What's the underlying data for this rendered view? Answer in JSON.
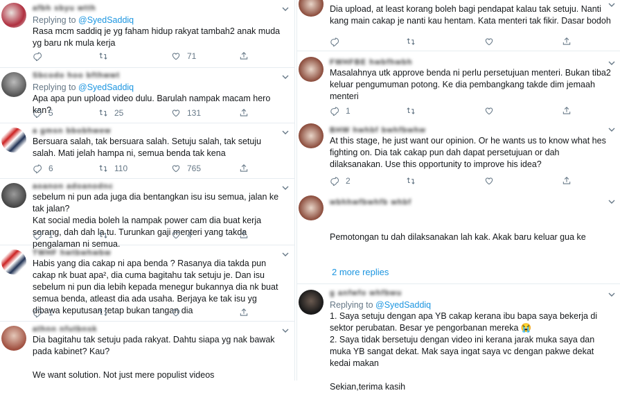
{
  "left": [
    {
      "name": "afbh sbyu wtth",
      "reply": "@SyedSaddiq",
      "text": "Rasa mcm saddiq je yg faham hidup rakyat tambah2 anak muda yg baru nk mula kerja",
      "replies": "",
      "retweets": "",
      "likes": "71"
    },
    {
      "name": "Sbcodo hoo bfthwwt",
      "reply": "@SyedSaddiq",
      "text": "Apa apa pun upload video dulu. Barulah nampak macam hero kan?",
      "replies": "5",
      "retweets": "25",
      "likes": "131"
    },
    {
      "name": "a gmsn bbobhwew",
      "reply": "",
      "text": "Bersuara salah, tak bersuara salah. Setuju salah, tak setuju salah. Mati jelah hampa ni, semua benda tak kena",
      "replies": "6",
      "retweets": "110",
      "likes": "765"
    },
    {
      "name": "aoanon adoanodnc",
      "reply": "",
      "text": "sebelum ni pun ada juga dia bentangkan isu isu semua, jalan ke tak jalan?\nKat social media boleh la nampak power cam dia buat kerja sorang, dah dah la tu. Turunkan gaji menteri yang takda pengalaman ni semua.",
      "replies": "1",
      "retweets": "",
      "likes": "4"
    },
    {
      "name": "TWHF hwtbwhwbw",
      "reply": "",
      "text": "Habis yang dia cakap ni apa benda ? Rasanya dia takda pun cakap nk buat apa², dia cuma bagitahu tak setuju je. Dan isu sebelum ni pun dia lebih kepada menegur bukannya dia nk buat semua benda, atleast dia ada usaha. Berjaya ke tak isu yg dibawa keputusan tetap bukan tangan dia",
      "replies": "1",
      "retweets": "",
      "likes": ""
    },
    {
      "name": "athnn nfutbnsk",
      "reply": "",
      "text": "Dia bagitahu tak setuju pada rakyat. Dahtu siapa yg nak bawak pada kabinet? Kau?\n\nWe want solution. Not just mere populist videos",
      "replies": "",
      "retweets": "",
      "likes": ""
    }
  ],
  "right": [
    {
      "name": "",
      "reply": "",
      "text": "Dia upload, at least korang boleh bagi pendapat kalau tak setuju. Nanti kang main cakap je nanti kau hentam. Kata menteri tak fikir. Dasar bodoh",
      "replies": "",
      "retweets": "",
      "likes": ""
    },
    {
      "name": "FWHFBE hwbfhwbh",
      "reply": "",
      "text": "Masalahnya utk approve benda ni perlu persetujuan menteri. Bukan tiba2 keluar pengumuman potong. Ke dia pembangkang takde dim jemaah menteri",
      "replies": "1",
      "retweets": "",
      "likes": ""
    },
    {
      "name": "BHW hwhbf bwhfbwhw",
      "reply": "",
      "text": "At this stage, he just want our opinion. Or he wants us to know what hes fighting on. Dia tak cakap pun dah dapat persetujuan or dah dilaksanakan. Use this opportunity to improve his idea?",
      "replies": "2",
      "retweets": "",
      "likes": ""
    },
    {
      "name": "wbhhwfbwhfb whbf",
      "reply": "",
      "text": "Pemotongan tu dah dilaksanakan lah kak. Akak baru keluar gua ke",
      "replies": "",
      "retweets": "",
      "likes": ""
    },
    {
      "name": "g anfwfo whfbwu",
      "reply": "@SyedSaddiq",
      "text": "1. Saya setuju dengan apa YB cakap kerana ibu bapa saya bekerja di sektor perubatan. Besar ye pengorbanan mereka 😭\n2. Saya tidak bersetuju dengan video ini kerana jarak muka saya dan muka YB sangat dekat. Mak saya ingat saya vc dengan pakwe dekat kedai makan\n\nSekian,terima kasih",
      "replies": "",
      "retweets": "",
      "likes": ""
    }
  ],
  "labels": {
    "replying_to": "Replying to",
    "more_replies": "2 more replies"
  },
  "colors": {
    "link": "#1b95e0",
    "muted": "#657786",
    "text": "#14171a",
    "divider": "#e6ecf0"
  }
}
